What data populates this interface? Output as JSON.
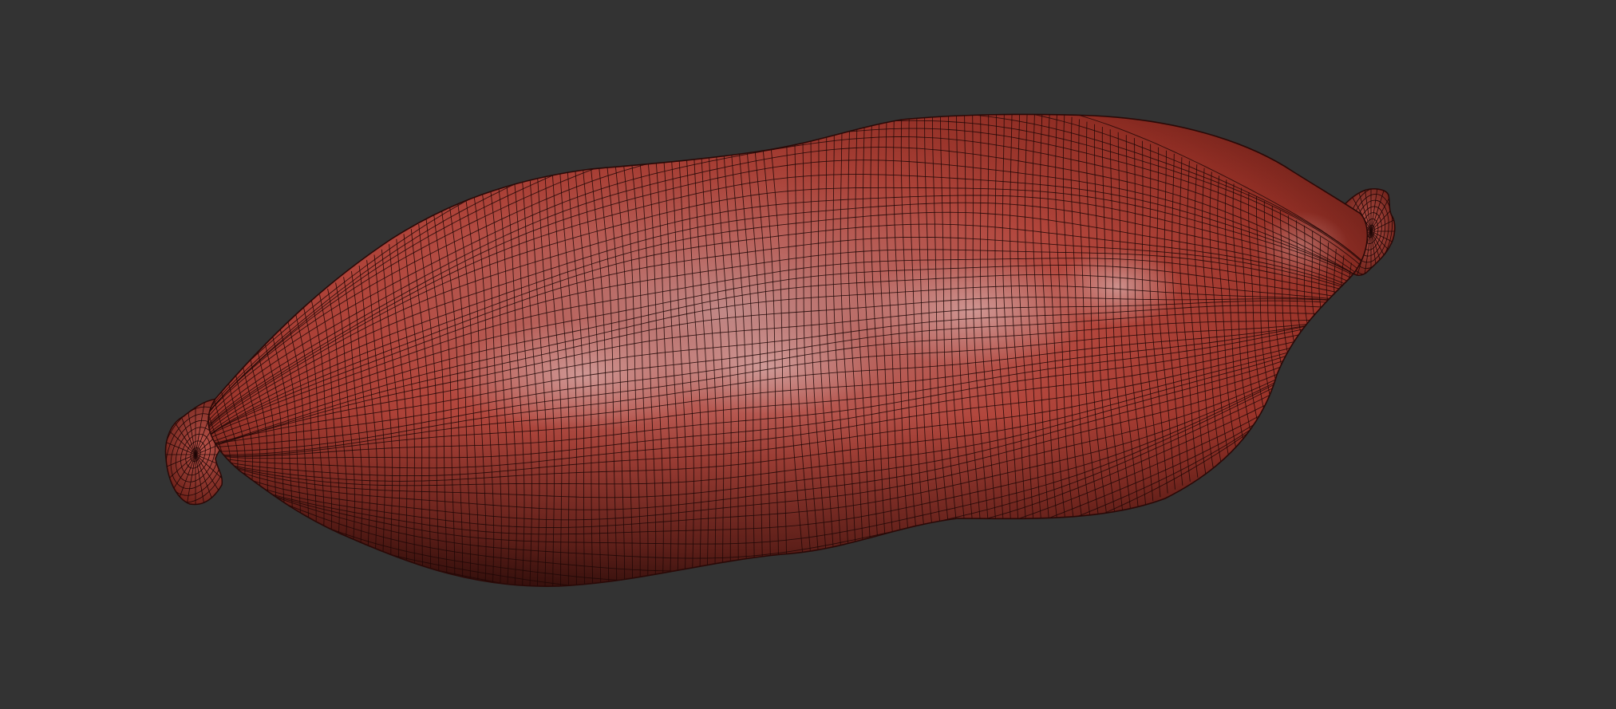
{
  "viewport": {
    "background_color": "#333333"
  },
  "model": {
    "object": "sweet-potato",
    "display_mode": "polyframe-wireframe",
    "surface_colors": {
      "base": "#b5423a",
      "highlight": "#c48a86",
      "shadow": "#5a1812",
      "wire": "#1f0706"
    },
    "wireframe_visible": true
  }
}
